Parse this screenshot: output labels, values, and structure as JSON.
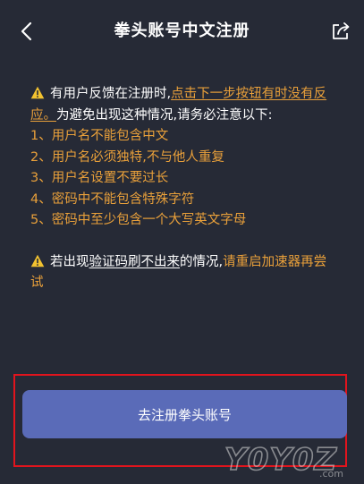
{
  "header": {
    "title": "拳头账号中文注册",
    "back_icon": "chevron-left-icon",
    "share_icon": "share-icon"
  },
  "notice": {
    "intro_p1": "有用户反馈在注册时,",
    "intro_link": "点击下一步按钮有时没有反应。",
    "intro_p2": "为避免出现这种情况,请务必注意以下:",
    "items": [
      "1、用户名不能包含中文",
      "2、用户名必须独特,不与他人重复",
      "3、用户名设置不要过长",
      "4、密码中不能包含特殊字符",
      "5、密码中至少包含一个大写英文字母"
    ],
    "captcha_p1": "若出现",
    "captcha_link": "验证码刷不出来",
    "captcha_p2": "的情况,",
    "captcha_action": "请重启加速器再尝试"
  },
  "cta": {
    "label": "去注册拳头账号"
  },
  "watermark": {
    "text": "Y0Y0Z.com"
  },
  "colors": {
    "background": "#262a36",
    "accent_orange": "#e9a03a",
    "button_blue": "#5a6bb8",
    "highlight_red": "#e1141d"
  }
}
